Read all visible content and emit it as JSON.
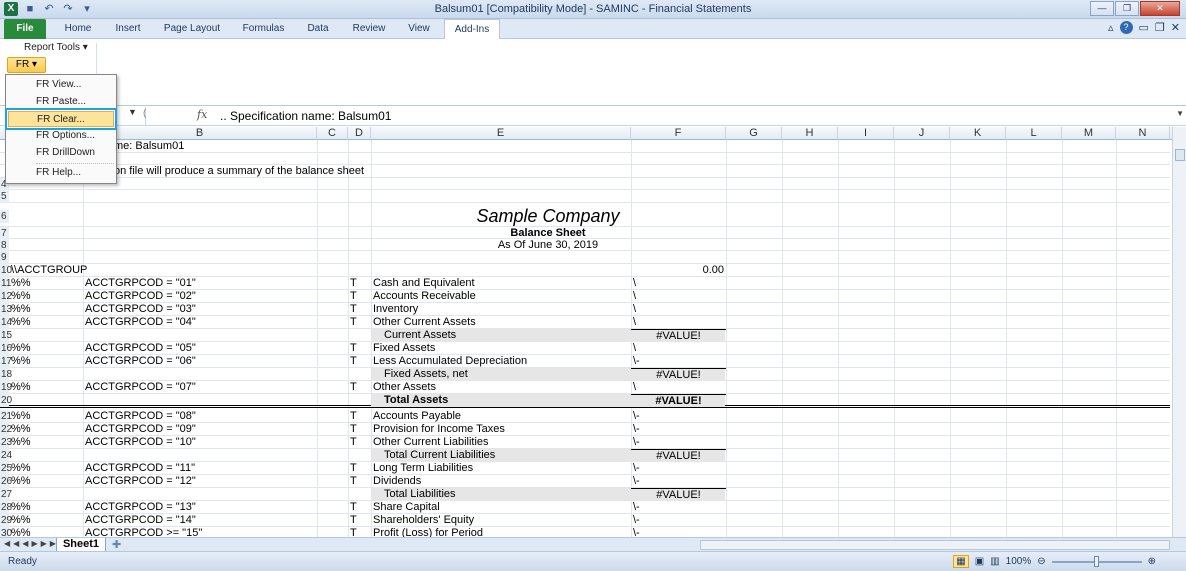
{
  "window": {
    "title": "Balsum01  [Compatibility Mode]  -  SAMINC - Financial Statements"
  },
  "ribbon_tabs": [
    "File",
    "Home",
    "Insert",
    "Page Layout",
    "Formulas",
    "Data",
    "Review",
    "View",
    "Add-Ins"
  ],
  "ribbon": {
    "report_tools": "Report Tools ▾",
    "fr_button": "FR ▾"
  },
  "fr_menu": {
    "items": [
      "FR View...",
      "FR Paste...",
      "FR Clear...",
      "FR Options...",
      "FR DrillDown",
      "FR Help..."
    ],
    "highlighted": "FR Clear..."
  },
  "formula_bar": {
    "fx": "fx",
    "content": ".. Specification name: Balsum01"
  },
  "columns": [
    "B",
    "C",
    "D",
    "E",
    "F",
    "G",
    "H",
    "I",
    "J",
    "K",
    "L",
    "M",
    "N"
  ],
  "rows": {
    "r1": {
      "num": "1",
      "b": "me: Balsum01"
    },
    "r3": {
      "num": "3",
      "b": "on file will produce a summary of the balance sheet"
    },
    "r4": {
      "num": "4"
    },
    "r5": {
      "num": "5"
    },
    "r6": {
      "num": "6",
      "e": "Sample Company"
    },
    "r7": {
      "num": "7",
      "e": "Balance Sheet"
    },
    "r8": {
      "num": "8",
      "e": "As Of June 30, 2019"
    },
    "r9": {
      "num": "9"
    },
    "r10": {
      "num": "10",
      "a": "\\\\ACCTGROUP",
      "f": "0.00"
    },
    "r11": {
      "num": "11",
      "a": "%%",
      "b": "ACCTGRPCOD = \"01\"",
      "d": "T",
      "e": "Cash and Equivalent",
      "f": "\\"
    },
    "r12": {
      "num": "12",
      "a": "%%",
      "b": "ACCTGRPCOD = \"02\"",
      "d": "T",
      "e": "Accounts Receivable",
      "f": "\\"
    },
    "r13": {
      "num": "13",
      "a": "%%",
      "b": "ACCTGRPCOD = \"03\"",
      "d": "T",
      "e": "Inventory",
      "f": "\\"
    },
    "r14": {
      "num": "14",
      "a": "%%",
      "b": "ACCTGRPCOD = \"04\"",
      "d": "T",
      "e": "Other Current Assets",
      "f": "\\"
    },
    "r15": {
      "num": "15",
      "e": "Current Assets",
      "f": "#VALUE!"
    },
    "r16": {
      "num": "16",
      "a": "%%",
      "b": "ACCTGRPCOD = \"05\"",
      "d": "T",
      "e": "Fixed Assets",
      "f": "\\"
    },
    "r17": {
      "num": "17",
      "a": "%%",
      "b": "ACCTGRPCOD = \"06\"",
      "d": "T",
      "e": "Less Accumulated Depreciation",
      "f": "\\-"
    },
    "r18": {
      "num": "18",
      "e": "Fixed Assets, net",
      "f": "#VALUE!"
    },
    "r19": {
      "num": "19",
      "a": "%%",
      "b": "ACCTGRPCOD = \"07\"",
      "d": "T",
      "e": "Other Assets",
      "f": "\\"
    },
    "r20": {
      "num": "20",
      "e": "Total Assets",
      "f": "#VALUE!"
    },
    "r21": {
      "num": "21",
      "a": "%%",
      "b": "ACCTGRPCOD = \"08\"",
      "d": "T",
      "e": "Accounts Payable",
      "f": "\\-"
    },
    "r22": {
      "num": "22",
      "a": "%%",
      "b": "ACCTGRPCOD = \"09\"",
      "d": "T",
      "e": "Provision for Income Taxes",
      "f": "\\-"
    },
    "r23": {
      "num": "23",
      "a": "%%",
      "b": "ACCTGRPCOD = \"10\"",
      "d": "T",
      "e": "Other Current Liabilities",
      "f": "\\-"
    },
    "r24": {
      "num": "24",
      "e": "Total Current Liabilities",
      "f": "#VALUE!"
    },
    "r25": {
      "num": "25",
      "a": "%%",
      "b": "ACCTGRPCOD = \"11\"",
      "d": "T",
      "e": "Long Term Liabilities",
      "f": "\\-"
    },
    "r26": {
      "num": "26",
      "a": "%%",
      "b": "ACCTGRPCOD = \"12\"",
      "d": "T",
      "e": "Dividends",
      "f": "\\-"
    },
    "r27": {
      "num": "27",
      "e": "Total Liabilities",
      "f": "#VALUE!"
    },
    "r28": {
      "num": "28",
      "a": "%%",
      "b": "ACCTGRPCOD = \"13\"",
      "d": "T",
      "e": "Share Capital",
      "f": "\\-"
    },
    "r29": {
      "num": "29",
      "a": "%%",
      "b": "ACCTGRPCOD = \"14\"",
      "d": "T",
      "e": "Shareholders' Equity",
      "f": "\\-"
    },
    "r30": {
      "num": "30",
      "a": "%%",
      "b": "ACCTGRPCOD >= \"15\"",
      "d": "T",
      "e": "Profit (Loss) for Period",
      "f": "\\-"
    }
  },
  "sheet_tab": "Sheet1",
  "status": {
    "ready": "Ready",
    "zoom": "100%"
  },
  "colors": {
    "file_tab": "#2a8a3c",
    "highlight": "#fde49b",
    "highlight_outline": "#1ca3e3"
  }
}
